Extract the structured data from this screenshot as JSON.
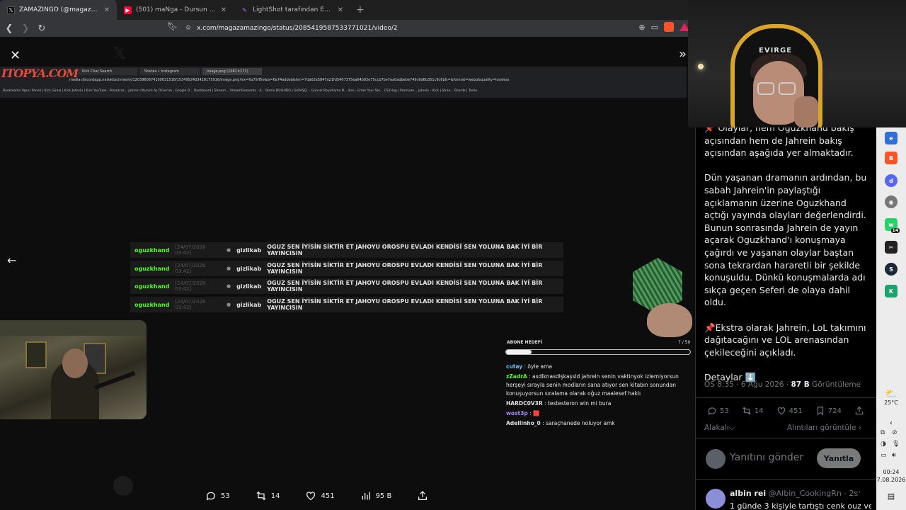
{
  "browser": {
    "tabs": [
      {
        "title": "ZAMAZİNGO (@magazamazingo)",
        "favicon": "x-icon",
        "active": true
      },
      {
        "title": "(501) maNga - Dursun Zaman ft. Gökhan",
        "favicon": "youtube-icon",
        "active": false
      },
      {
        "title": "LightShot tarafından Ekran Görüntüsü",
        "favicon": "lightshot-icon",
        "active": false
      }
    ],
    "new_tab": "+",
    "url": "x.com/magazamazingo/status/2085419587533771021/video/2"
  },
  "video": {
    "inner": {
      "logo": "ITOPYA.COM",
      "tabs": [
        "Kick Chat Search",
        "Stories • Instagram",
        "image.png (1061×171)"
      ],
      "url": "media.discordapp.net/attachments/1203960674100031518/1534952403428175916/image.png?ex=6a75ff5e&is=6a74addeb&hm=7da02a5847a21fd5467375ea64b92e75ccb7be7ea0adbebe749c6d6b351c9c6b&=&format=webp&quality=lossless",
      "bookmarks": "Bookmarks   Yapıcı Paneli | Kick   Günel | Kick   Jahrein | Kick   YouTube - Broadcas...   Jahrein   Oturum Aç   Drive'ım - Google D...   Dashboard | Stream...   StreamElements - A...   Botrix   BUSHIDO | SAVAŞÇI...   Güncel Boyutlama N...   ikas - Enter Your Sto...   CS2Hug | Premium...   jahrein - Kick | Strea...   Boards | Trello"
    },
    "chat_lines": [
      {
        "user": "oguzkhand",
        "time": "[24/07/2026 03:42]",
        "target": "gizlikab",
        "message": "OGUZ SEN İYİSİN SİKTİR ET JAHOYU OROSPU EVLADI KENDİSİ SEN YOLUNA BAK İYİ BİR YAYINCISIN"
      },
      {
        "user": "oguzkhand",
        "time": "[24/07/2026 03:42]",
        "target": "gizlikab",
        "message": "OGUZ SEN İYİSİN SİKTİR ET JAHOYU OROSPU EVLADI KENDİSİ SEN YOLUNA BAK İYİ BİR YAYINCISIN"
      },
      {
        "user": "oguzkhand",
        "time": "[24/07/2026 03:42]",
        "target": "gizlikab",
        "message": "OGUZ SEN İYİSİN SİKTİR ET JAHOYU OROSPU EVLADI KENDİSİ SEN YOLUNA BAK İYİ BİR YAYINCISIN"
      },
      {
        "user": "oguzkhand",
        "time": "[24/07/2026 03:42]",
        "target": "gizlikab",
        "message": "OGUZ SEN İYİSİN SİKTİR ET JAHOYU OROSPU EVLADI KENDİSİ SEN YOLUNA BAK İYİ BİR YAYINCISIN"
      }
    ],
    "sub_goal": {
      "label": "ABONE HEDEFİ",
      "count": "7 / 50",
      "progress": 0.14
    },
    "kick_chat": [
      {
        "user": "cutay",
        "color": "#6fc3ff",
        "text": "öyle ama"
      },
      {
        "user": "zZadrA",
        "color": "#53fc18",
        "text": "asdlknasdlşkaşsld jahrein senin vaktinyok izlemiyorsun herşeyi sırayla senin modların sana atıyor sen kitabın sonundan konuşuyorsun sıralama olarak oğuz maalesef haklı"
      },
      {
        "user": "HARDC0V3R",
        "color": "#e0e0e0",
        "text": "testesteron win mi bura"
      },
      {
        "user": "wost3p",
        "color": "#a98bff",
        "text": "🟥"
      },
      {
        "user": "Adellinho_0",
        "color": "#e0e0e0",
        "text": "saraçhanede noluyor amk"
      }
    ],
    "actions": {
      "replies": "53",
      "reposts": "14",
      "likes": "451",
      "views": "95 B"
    }
  },
  "tweet": {
    "paragraphs": [
      "📌 Olaylar, hem Oguzkhand bakış açısından hem de Jahrein bakış açısından aşağıda yer almaktadır.",
      "Dün yaşanan dramanın ardından, bu sabah Jahrein'in paylaştığı açıklamanın üzerine Oguzkhand açtığı yayında olayları değerlendirdi. Bunun sonrasında Jahrein de yayın açarak Oguzkhand'ı konuşmaya çağırdı ve yaşanan olaylar baştan sona tekrardan hararetli bir şekilde konuşuldu. Dünkü konuşmalarda adı sıkça geçen Seferi de olaya dahil oldu.",
      "📌Ekstra olarak Jahrein, LoL takımını dağıtacağını ve LOL arenasından çekileceğini açıkladı.",
      "Detaylar ⬇️"
    ],
    "time": "ÖS 8:35 · 6 Ağu 2026 · ",
    "views_count": "87 B",
    "views_label": " Görüntüleme",
    "actions": {
      "replies": "53",
      "reposts": "14",
      "likes": "451",
      "bookmarks": "724"
    },
    "relevant": "Alakalı⌵",
    "quotes": "Alıntıları görüntüle ›",
    "reply_placeholder": "Yanıtını gönder",
    "reply_button": "Yanıtla",
    "first_reply": {
      "name": "albin rei",
      "handle": "@Albin_CookingRn · 2s",
      "text": "1 günde 3 kişiyle tartıştı cenk ouz ve"
    }
  },
  "webcam": {
    "chair_logo": "EVIRGE"
  },
  "taskbar": {
    "weather": "25°C",
    "time": "00:24",
    "date": "7.08.2026",
    "badges": {
      "whatsapp": "14"
    }
  }
}
